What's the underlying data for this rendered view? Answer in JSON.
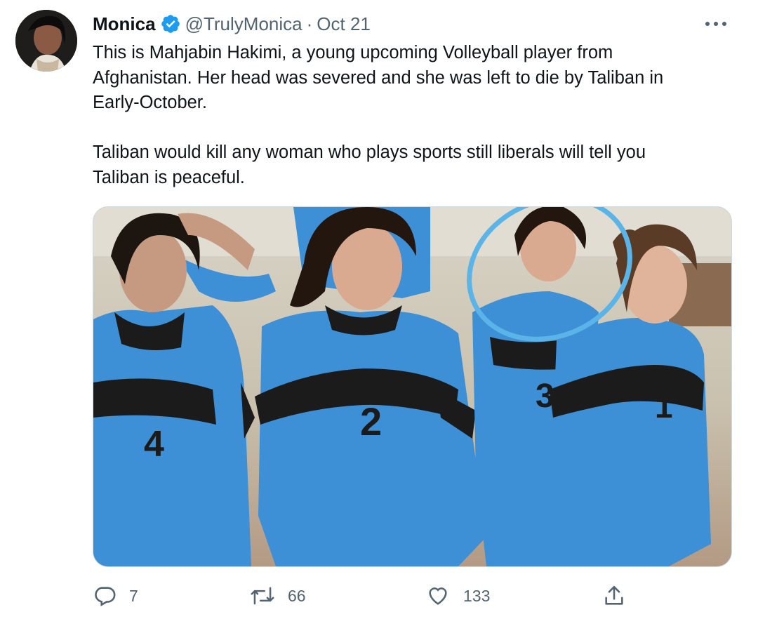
{
  "tweet": {
    "author_name": "Monica",
    "handle": "@TrulyMonica",
    "separator": "·",
    "date": "Oct 21",
    "text": "This is Mahjabin Hakimi, a young upcoming Volleyball player from\nAfghanistan. Her head was severed and she was left to die by Taliban in\nEarly-October.\n\nTaliban would kill any woman who plays sports still liberals will tell you\nTaliban is peaceful.",
    "media": {
      "description_icon": "photo",
      "jersey_numbers": [
        "4",
        "2",
        "3",
        "1"
      ]
    },
    "actions": {
      "reply_count": "7",
      "retweet_count": "66",
      "like_count": "133"
    }
  },
  "colors": {
    "text": "#0f1419",
    "secondary": "#536471",
    "verified": "#1d9bf0",
    "jersey_blue": "#3d8fd6",
    "highlight_circle": "#5ab4e8"
  }
}
